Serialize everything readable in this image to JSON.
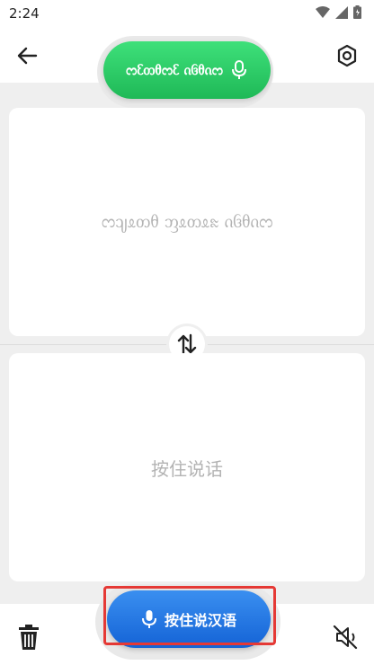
{
  "status": {
    "time": "2:24"
  },
  "header": {
    "language_button_label": "ᦂᦷᦎᦲᦂᦷ ᦵᦑᦲᦵᦂ"
  },
  "panels": {
    "source_placeholder": "ᦂᦻᦸᦎᦲ ᦀᦸᦎᦸᦰ ᦵᦑᦲᦵᦂ",
    "target_placeholder": "按住说话"
  },
  "footer": {
    "speak_button_label": "按住说汉语"
  },
  "colors": {
    "green_button": "#2fc964",
    "blue_button": "#1f74e0",
    "highlight": "#e53935"
  }
}
